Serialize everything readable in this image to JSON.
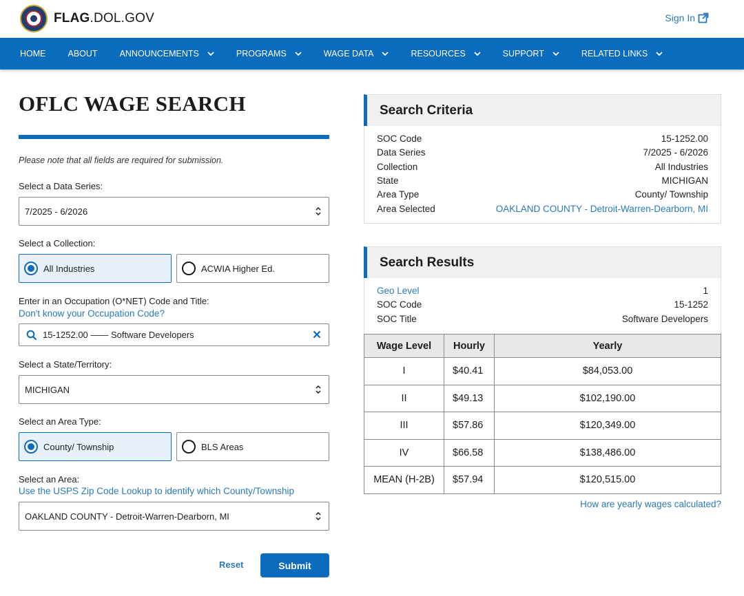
{
  "header": {
    "brand_bold": "FLAG",
    "brand_rest": ".DOL.GOV",
    "signin_label": "Sign In",
    "logo_icon": "dol-seal-icon",
    "accent_color": "#0b6bbd"
  },
  "nav": {
    "items": [
      {
        "label": "HOME",
        "has_menu": false
      },
      {
        "label": "ABOUT",
        "has_menu": false
      },
      {
        "label": "ANNOUNCEMENTS",
        "has_menu": true
      },
      {
        "label": "PROGRAMS",
        "has_menu": true
      },
      {
        "label": "WAGE DATA",
        "has_menu": true
      },
      {
        "label": "RESOURCES",
        "has_menu": true
      },
      {
        "label": "SUPPORT",
        "has_menu": true
      },
      {
        "label": "RELATED LINKS",
        "has_menu": true
      }
    ]
  },
  "form": {
    "title": "OFLC WAGE SEARCH",
    "note": "Please note that all fields are required for submission.",
    "data_series_label": "Select a Data Series:",
    "data_series_value": "7/2025 - 6/2026",
    "collection_label": "Select a Collection:",
    "collection_options": [
      "All Industries",
      "ACWIA Higher Ed."
    ],
    "collection_selected": "All Industries",
    "occupation_label": "Enter in an Occupation (O*NET) Code and Title:",
    "occupation_help_link": "Don't know your Occupation Code?",
    "occupation_value": "15-1252.00 —— Software Developers",
    "state_label": "Select a State/Territory:",
    "state_value": "MICHIGAN",
    "area_type_label": "Select an Area Type:",
    "area_type_options": [
      "County/ Township",
      "BLS Areas"
    ],
    "area_type_selected": "County/ Township",
    "area_label": "Select an Area:",
    "area_help_link": "Use the USPS Zip Code Lookup to identify which County/Township",
    "area_value": "OAKLAND COUNTY - Detroit-Warren-Dearborn, MI",
    "reset_label": "Reset",
    "submit_label": "Submit"
  },
  "criteria": {
    "title": "Search Criteria",
    "rows": [
      {
        "key": "SOC Code",
        "value": "15-1252.00"
      },
      {
        "key": "Data Series",
        "value": "7/2025 - 6/2026"
      },
      {
        "key": "Collection",
        "value": "All Industries"
      },
      {
        "key": "State",
        "value": "MICHIGAN"
      },
      {
        "key": "Area Type",
        "value": "County/ Township"
      },
      {
        "key": "Area Selected",
        "value": "OAKLAND COUNTY - Detroit-Warren-Dearborn, MI"
      }
    ]
  },
  "results": {
    "title": "Search Results",
    "rows": [
      {
        "key": "Geo Level",
        "value": "1"
      },
      {
        "key": "SOC Code",
        "value": "15-1252"
      },
      {
        "key": "SOC Title",
        "value": "Software Developers"
      }
    ],
    "table": {
      "headers": [
        "Wage Level",
        "Hourly",
        "Yearly"
      ],
      "rows": [
        [
          "I",
          "$40.41",
          "$84,053.00"
        ],
        [
          "II",
          "$49.13",
          "$102,190.00"
        ],
        [
          "III",
          "$57.86",
          "$120,349.00"
        ],
        [
          "IV",
          "$66.58",
          "$138,486.00"
        ],
        [
          "MEAN (H-2B)",
          "$57.94",
          "$120,515.00"
        ]
      ]
    },
    "calc_link": "How are yearly wages calculated?"
  }
}
